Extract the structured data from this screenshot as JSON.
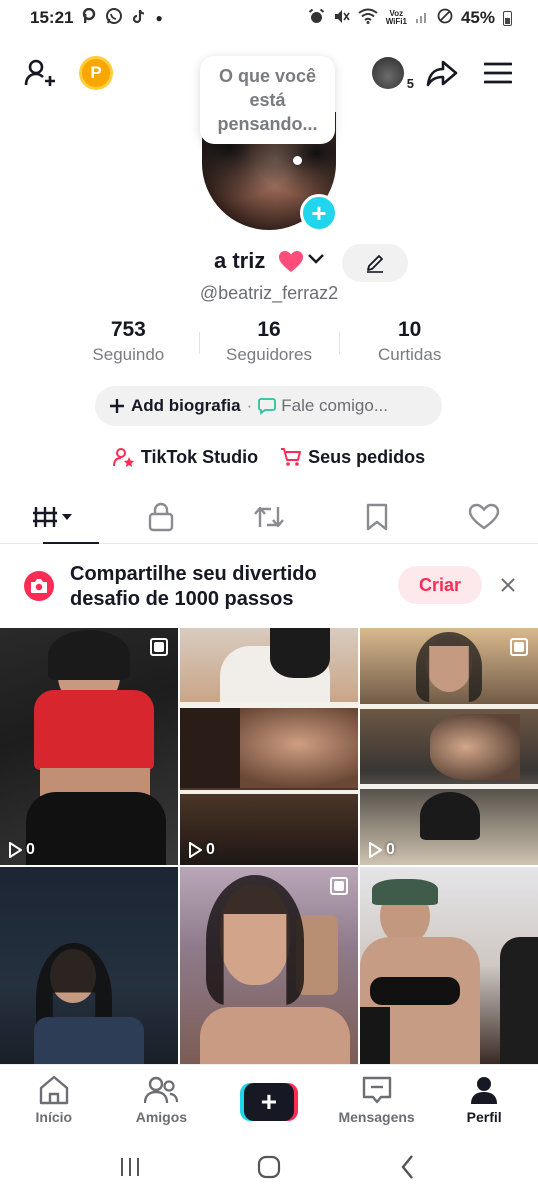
{
  "status_bar": {
    "time": "15:21",
    "network_label_top": "Voz",
    "network_label_bottom": "WiFi1",
    "battery": "45%"
  },
  "top_bar": {
    "follower_count_badge": "5"
  },
  "profile": {
    "thought_bubble": "O que você está pensando...",
    "display_name": "a triz",
    "username": "@beatriz_ferraz2"
  },
  "stats": [
    {
      "value": "753",
      "label": "Seguindo"
    },
    {
      "value": "16",
      "label": "Seguidores"
    },
    {
      "value": "10",
      "label": "Curtidas"
    }
  ],
  "bio": {
    "add_label": "Add biografia",
    "separator": "·",
    "chat_label": "Fale comigo..."
  },
  "links": {
    "studio": "TikTok Studio",
    "orders": "Seus pedidos"
  },
  "banner": {
    "text": "Compartilhe seu divertido desafio de 1000 passos",
    "button": "Criar"
  },
  "grid": {
    "video_views": [
      "0",
      "0",
      "0"
    ]
  },
  "bottom_nav": {
    "items": [
      "Início",
      "Amigos",
      "Mensagens",
      "Perfil"
    ]
  },
  "colors": {
    "accent": "#fe2c55",
    "cyan": "#20d5ec",
    "text": "#161823"
  }
}
